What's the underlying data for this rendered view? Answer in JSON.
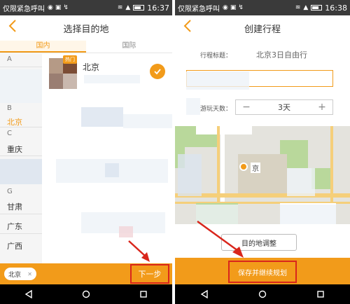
{
  "colors": {
    "accent": "#f29b1a",
    "highlight": "#d9261c",
    "statusbar": "#3a3a3a"
  },
  "left": {
    "statusbar": {
      "carrier": "仅限紧急呼叫",
      "time": "16:37"
    },
    "header": {
      "title": "选择目的地",
      "back_icon": "chevron-left-icon"
    },
    "tabs": [
      {
        "label": "国内",
        "active": true
      },
      {
        "label": "国际",
        "active": false
      }
    ],
    "index": {
      "letters": [
        "A",
        "B",
        "C",
        "G"
      ],
      "cities": [
        "北京",
        "重庆",
        "甘肃",
        "广东",
        "广西"
      ],
      "active_city": "北京"
    },
    "card": {
      "badge": "热门",
      "name": "北京",
      "selected": true
    },
    "bottom": {
      "chip": "北京",
      "next_button": "下一步"
    }
  },
  "right": {
    "statusbar": {
      "carrier": "仅限紧急呼叫",
      "time": "16:38"
    },
    "header": {
      "title": "创建行程",
      "back_icon": "chevron-left-icon"
    },
    "form": {
      "title_label": "行程标题：",
      "title_value": "北京3日自由行",
      "days_label": "游玩天数：",
      "days_value": "3天",
      "minus": "−",
      "plus": "+"
    },
    "map": {
      "label": "京"
    },
    "adjust_button": "目的地调整",
    "save_button": "保存并继续规划"
  }
}
